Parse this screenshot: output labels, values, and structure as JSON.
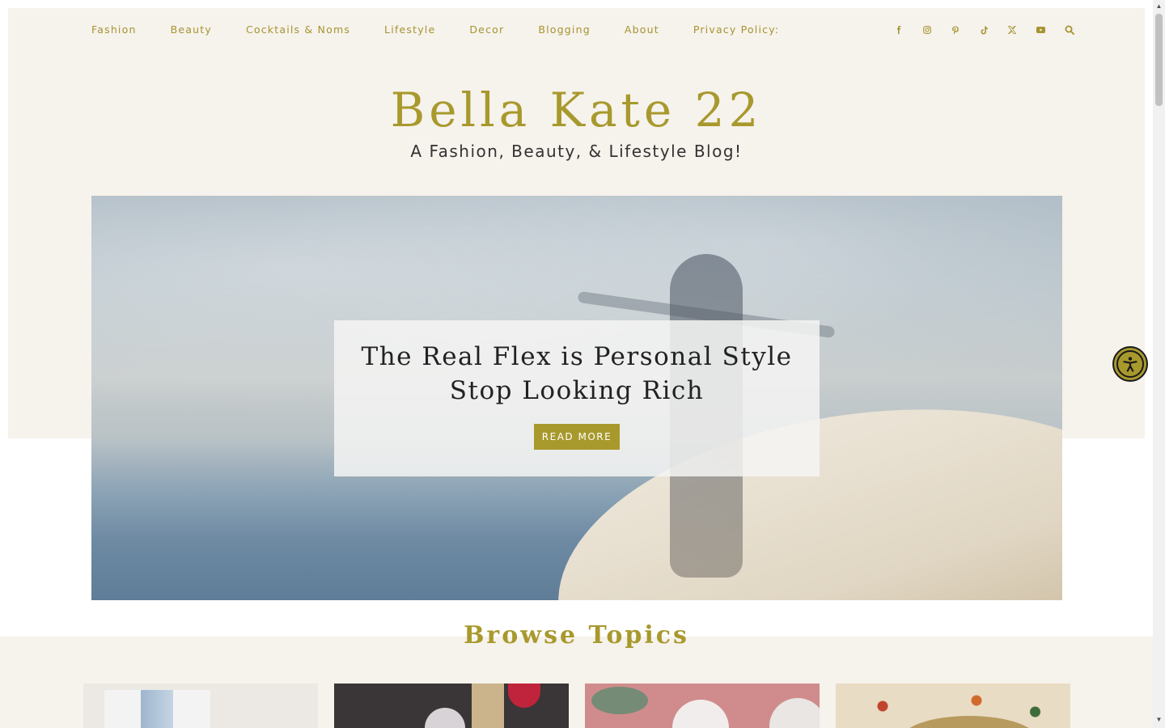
{
  "nav": {
    "items": [
      "Fashion",
      "Beauty",
      "Cocktails & Noms",
      "Lifestyle",
      "Decor",
      "Blogging",
      "About",
      "Privacy Policy:"
    ]
  },
  "social": {
    "icons": [
      "facebook-icon",
      "instagram-icon",
      "pinterest-icon",
      "tiktok-icon",
      "x-icon",
      "youtube-icon",
      "search-icon"
    ]
  },
  "header": {
    "title": "Bella Kate 22",
    "tagline": "A Fashion, Beauty, & Lifestyle Blog!"
  },
  "hero": {
    "title_line1": "The Real Flex is Personal Style",
    "title_line2": "Stop Looking Rich",
    "button_label": "READ MORE"
  },
  "browse": {
    "title": "Browse Topics"
  },
  "colors": {
    "accent": "#a8992d",
    "band": "#f6f2ec",
    "text": "#333333"
  }
}
